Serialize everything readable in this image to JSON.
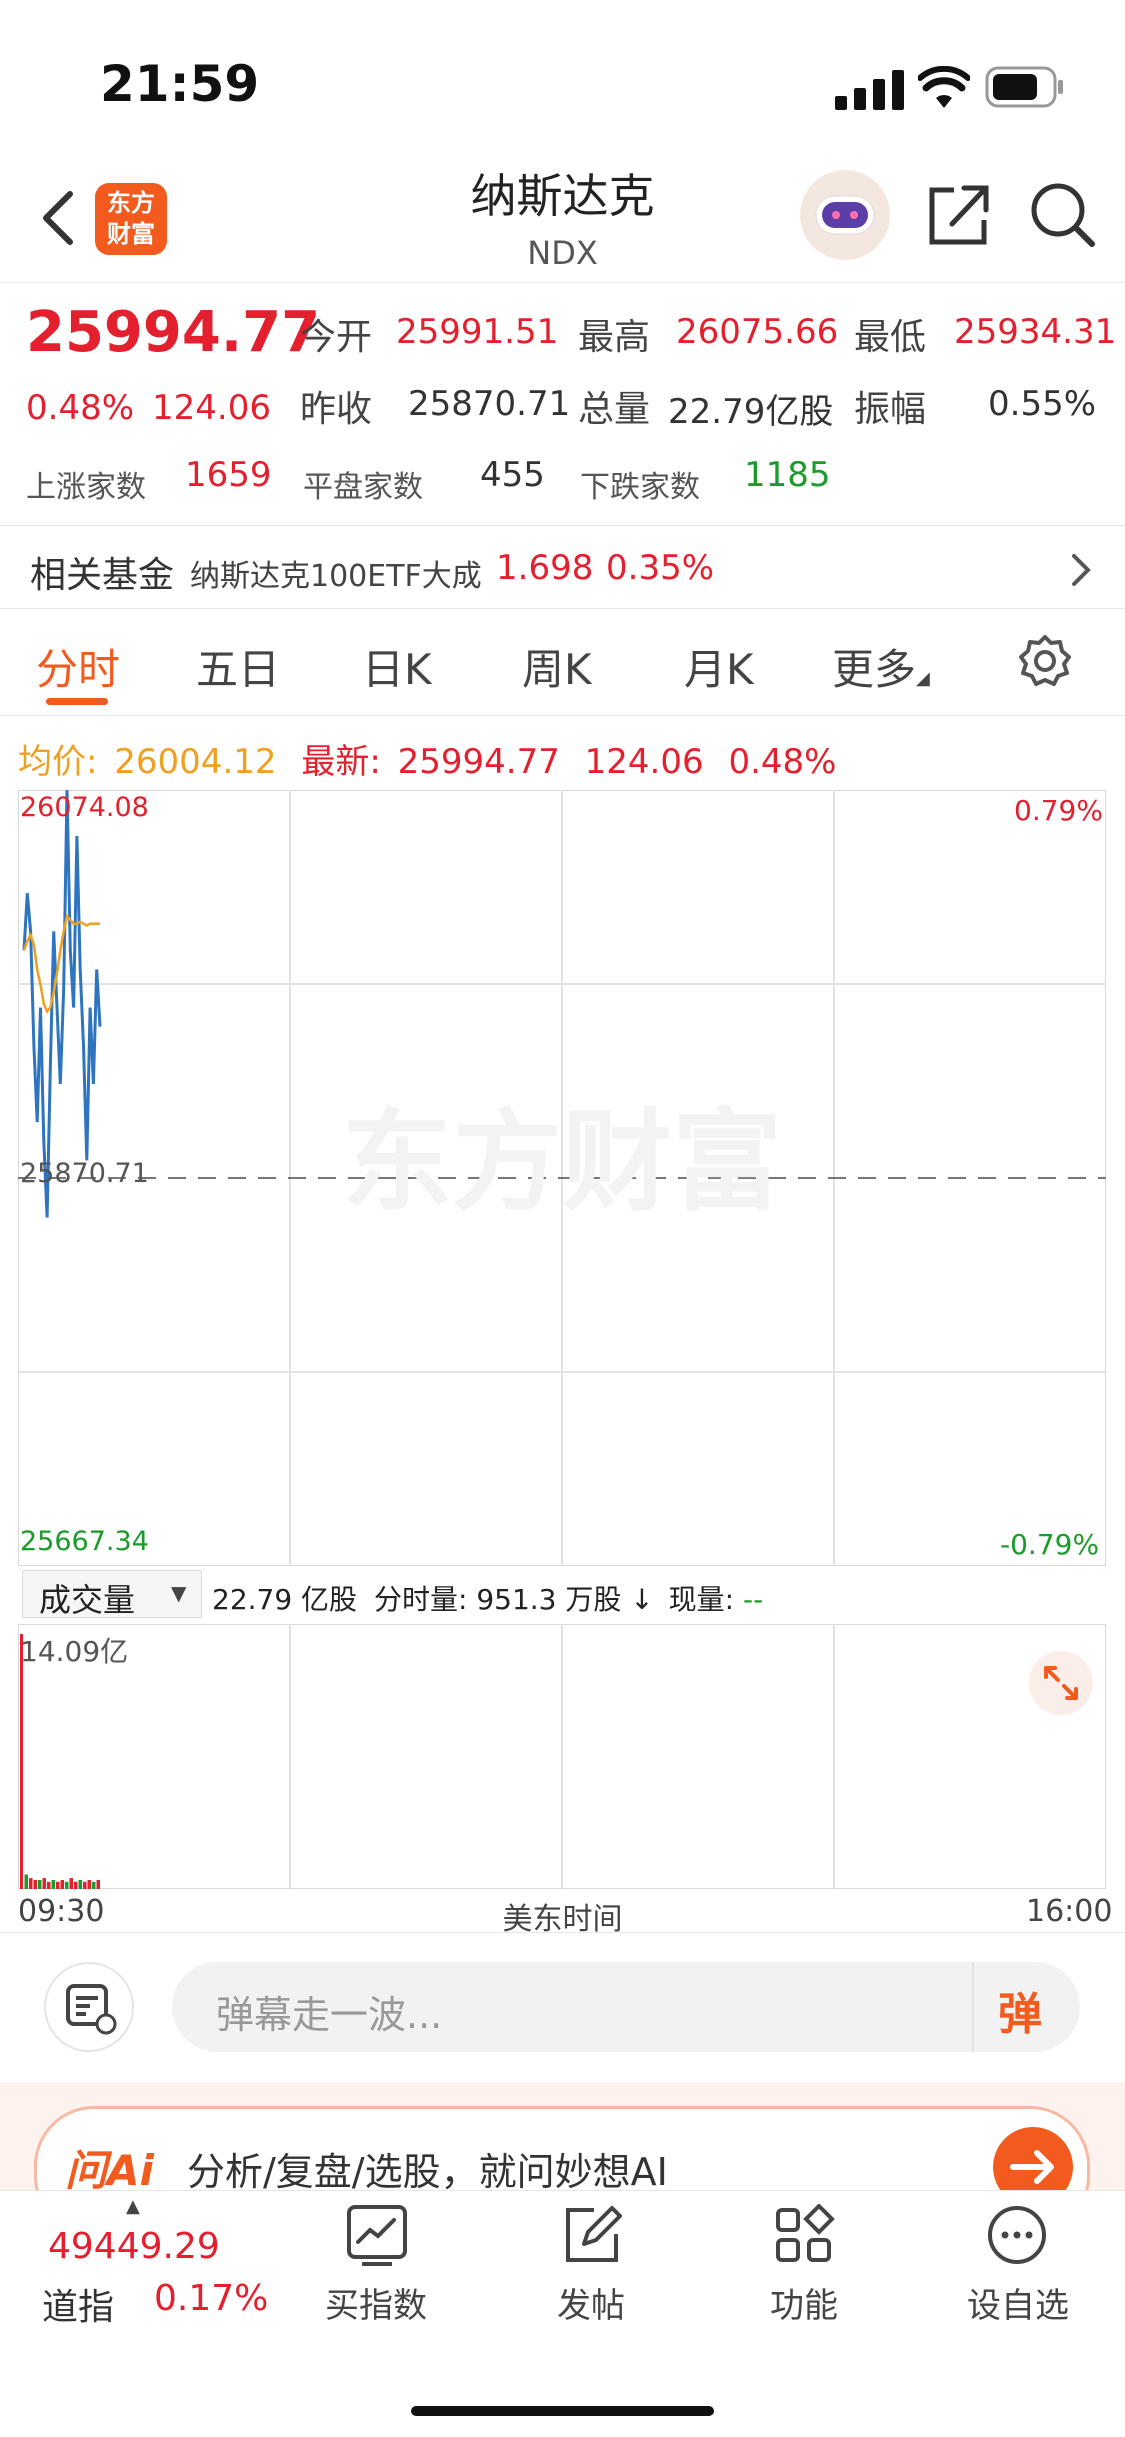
{
  "status": {
    "time": "21:59"
  },
  "header": {
    "logo_text": "东方\n财富",
    "title": "纳斯达克",
    "code": "NDX"
  },
  "quote": {
    "price": "25994.77",
    "change_pct": "0.48%",
    "change": "124.06",
    "open_label": "今开",
    "open": "25991.51",
    "high_label": "最高",
    "high": "26075.66",
    "low_label": "最低",
    "low": "25934.31",
    "prev_close_label": "昨收",
    "prev_close": "25870.71",
    "volume_label": "总量",
    "volume": "22.79亿股",
    "amplitude_label": "振幅",
    "amplitude": "0.55%",
    "up_label": "上涨家数",
    "up_count": "1659",
    "flat_label": "平盘家数",
    "flat_count": "455",
    "down_label": "下跌家数",
    "down_count": "1185"
  },
  "fund": {
    "label": "相关基金",
    "name": "纳斯达克100ETF大成",
    "price": "1.698",
    "pct": "0.35%"
  },
  "tabs": [
    "分时",
    "五日",
    "日K",
    "周K",
    "月K",
    "更多"
  ],
  "chart_info": {
    "avg_label": "均价:",
    "avg_value": "26004.12",
    "latest_label": "最新:",
    "latest_value": "25994.77",
    "latest_change": "124.06",
    "latest_pct": "0.48%"
  },
  "chart_data": {
    "type": "line",
    "y_top": "26074.08",
    "y_mid": "25870.71",
    "y_bottom": "25667.34",
    "pct_top": "0.79%",
    "pct_bottom": "-0.79%",
    "ylim": [
      25667.34,
      26074.08
    ],
    "watermark": "东方财富",
    "series": [
      {
        "color": "#2f74c0",
        "values": [
          25990,
          26020,
          26000,
          25940,
          25900,
          25960,
          25890,
          25850,
          25930,
          26000,
          25960,
          25920,
          25970,
          26074,
          25990,
          25960,
          26050,
          25980,
          25940,
          25880,
          25960,
          25920,
          25980,
          25950
        ]
      },
      {
        "color": "#f0a020",
        "values": [
          25990,
          25995,
          25998,
          25993,
          25980,
          25972,
          25962,
          25958,
          25960,
          25968,
          25978,
          25990,
          26000,
          26008,
          26006,
          26004,
          26004,
          26005,
          26004,
          26003,
          26004,
          26004,
          26004,
          26004
        ]
      }
    ],
    "x_start": "09:30",
    "x_mid": "美东时间",
    "x_end": "16:00"
  },
  "volume": {
    "selector": "成交量",
    "total": "22.79 亿股",
    "minute_label": "分时量:",
    "minute_value": "951.3 万股",
    "arrow": "↓",
    "current_label": "现量:",
    "current_value": "--",
    "max_label": "14.09亿",
    "bars": [
      14.09,
      0.8,
      0.6,
      0.5,
      0.5,
      0.6,
      0.4,
      0.5,
      0.4,
      0.5,
      0.4,
      0.6,
      0.4,
      0.5,
      0.4,
      0.5,
      0.4,
      0.5
    ]
  },
  "danmu": {
    "placeholder": "弹幕走一波...",
    "send_icon_label": "弹"
  },
  "ai_bar": {
    "logo": "问Ai",
    "text": "分析/复盘/选股，就问妙想AI"
  },
  "bottom_nav": {
    "index_value": "49449.29",
    "index_name": "道指",
    "index_pct": "0.17%",
    "items": [
      "买指数",
      "发帖",
      "功能",
      "设自选"
    ]
  }
}
